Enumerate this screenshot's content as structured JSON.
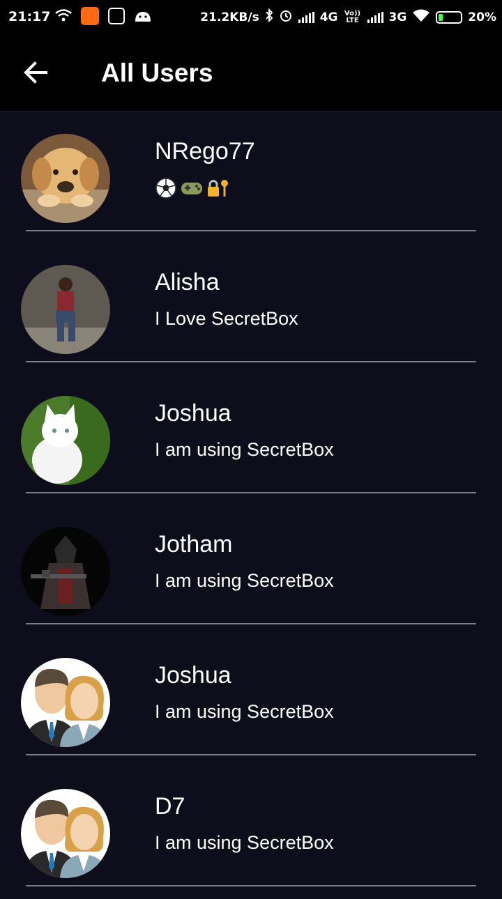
{
  "status_bar": {
    "time": "21:17",
    "net_speed": "21.2KB/s",
    "network_1": "4G",
    "volte": "Vo)) LTE",
    "network_2": "3G",
    "battery": "20%",
    "battery_level": 0.2
  },
  "toolbar": {
    "title": "All Users",
    "back_icon": "arrow-left-icon"
  },
  "users": [
    {
      "name": "NRego77",
      "status_icons": [
        "soccer-ball-icon",
        "game-controller-icon",
        "lock-key-icon"
      ],
      "avatar": "puppy-photo"
    },
    {
      "name": "Alisha",
      "status": "I Love SecretBox",
      "avatar": "woman-photo"
    },
    {
      "name": "Joshua",
      "status": "I am using SecretBox",
      "avatar": "white-cat-photo"
    },
    {
      "name": "Jotham",
      "status": "I am using SecretBox",
      "avatar": "assassin-photo"
    },
    {
      "name": "Joshua",
      "status": "I am using SecretBox",
      "avatar": "default-couple-avatar"
    },
    {
      "name": "D7",
      "status": "I am using SecretBox",
      "avatar": "default-couple-avatar"
    }
  ]
}
